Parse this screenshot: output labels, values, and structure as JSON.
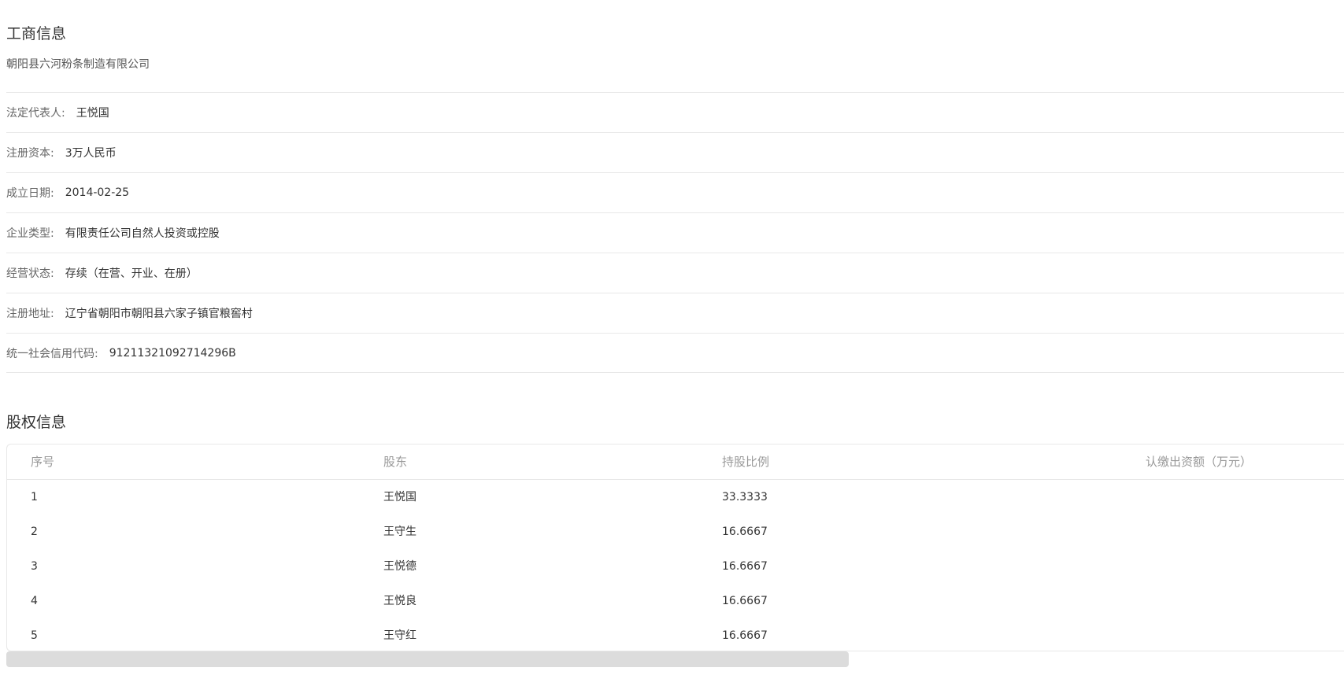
{
  "business_info": {
    "title": "工商信息",
    "company_name": "朝阳县六河粉条制造有限公司",
    "fields": [
      {
        "label": "法定代表人:",
        "value": "王悦国"
      },
      {
        "label": "注册资本:",
        "value": "3万人民币"
      },
      {
        "label": "成立日期:",
        "value": "2014-02-25"
      },
      {
        "label": "企业类型:",
        "value": "有限责任公司自然人投资或控股"
      },
      {
        "label": "经营状态:",
        "value": "存续（在营、开业、在册）"
      },
      {
        "label": "注册地址:",
        "value": "辽宁省朝阳市朝阳县六家子镇官粮窖村"
      },
      {
        "label": "统一社会信用代码:",
        "value": "91211321092714296B"
      }
    ]
  },
  "equity_info": {
    "title": "股权信息",
    "columns": [
      "序号",
      "股东",
      "持股比例",
      "认缴出资额（万元）"
    ],
    "rows": [
      {
        "index": "1",
        "holder": "王悦国",
        "ratio": "33.3333",
        "capital": ""
      },
      {
        "index": "2",
        "holder": "王守生",
        "ratio": "16.6667",
        "capital": ""
      },
      {
        "index": "3",
        "holder": "王悦德",
        "ratio": "16.6667",
        "capital": ""
      },
      {
        "index": "4",
        "holder": "王悦良",
        "ratio": "16.6667",
        "capital": ""
      },
      {
        "index": "5",
        "holder": "王守红",
        "ratio": "16.6667",
        "capital": ""
      }
    ]
  },
  "scrollbar": {
    "horizontal_position": 0.63
  }
}
